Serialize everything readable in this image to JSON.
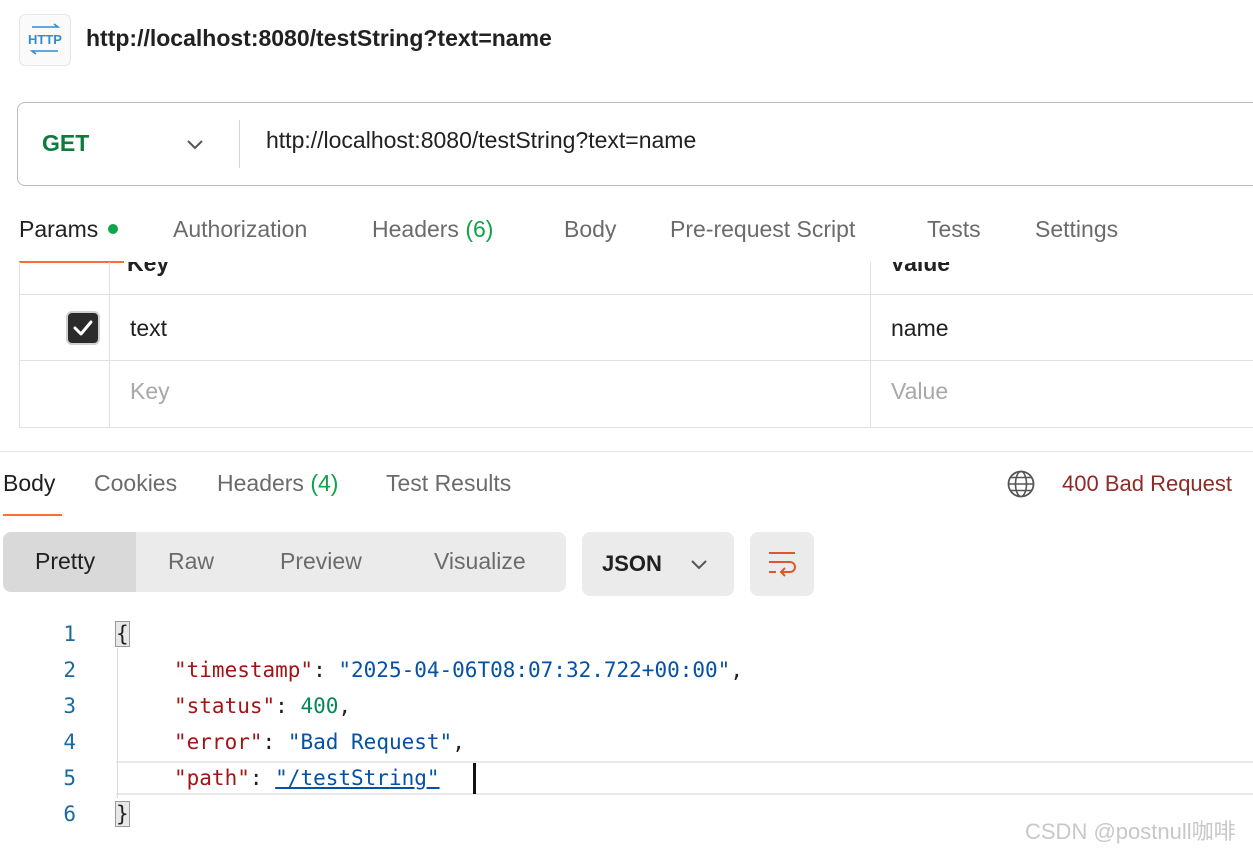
{
  "header": {
    "icon": "http-icon",
    "icon_text": "HTTP",
    "title": "http://localhost:8080/testString?text=name"
  },
  "request": {
    "method": "GET",
    "url": "http://localhost:8080/testString?text=name"
  },
  "request_tabs": {
    "params": "Params",
    "authorization": "Authorization",
    "headers": "Headers",
    "headers_count": "(6)",
    "body": "Body",
    "prerequest": "Pre-request Script",
    "tests": "Tests",
    "settings": "Settings"
  },
  "params_table": {
    "columns": [
      "Key",
      "Value"
    ],
    "rows": [
      {
        "checked": true,
        "key": "text",
        "value": "name"
      }
    ],
    "placeholders": {
      "key": "Key",
      "value": "Value"
    }
  },
  "response_tabs": {
    "body": "Body",
    "cookies": "Cookies",
    "headers": "Headers",
    "headers_count": "(4)",
    "test_results": "Test Results"
  },
  "status": {
    "text": "400 Bad Request",
    "color": "#8f2a28"
  },
  "view_modes": {
    "pretty": "Pretty",
    "raw": "Raw",
    "preview": "Preview",
    "visualize": "Visualize",
    "selected": "Pretty"
  },
  "format": {
    "selected": "JSON"
  },
  "code": {
    "line_numbers": [
      "1",
      "2",
      "3",
      "4",
      "5",
      "6"
    ],
    "open_brace": "{",
    "close_brace": "}",
    "timestamp_key": "\"timestamp\"",
    "timestamp_value": "\"2025-04-06T08:07:32.722+00:00\"",
    "status_key": "\"status\"",
    "status_value": "400",
    "error_key": "\"error\"",
    "error_value": "\"Bad Request\"",
    "path_key": "\"path\"",
    "path_value": "\"/testString\""
  },
  "watermark": "CSDN @postnull咖啡",
  "colors": {
    "accent": "#ff6c37",
    "get_method": "#0b7c3c",
    "active_green": "#0fa34a"
  }
}
